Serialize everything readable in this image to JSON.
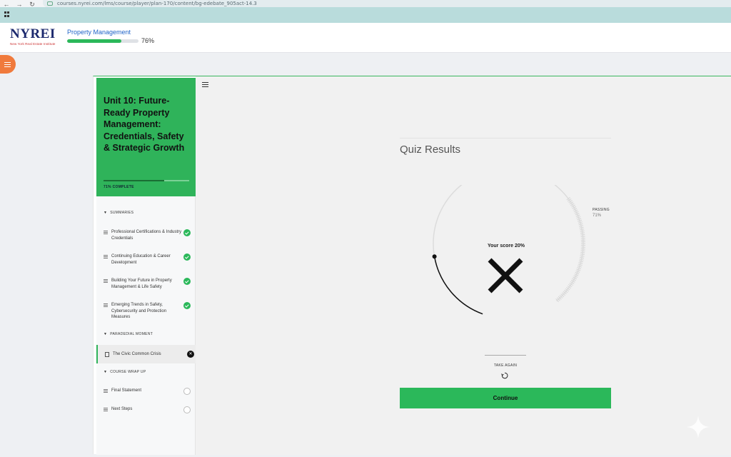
{
  "browser": {
    "url": "courses.nyrei.com/lms/course/player/plan-170/content/bg-edebate_905act-14.3",
    "back": "←",
    "forward": "→",
    "reload": "↻"
  },
  "header": {
    "logo_main": "NYREI",
    "logo_sub": "New York Real Estate Institute",
    "course_title": "Property Management",
    "progress_percent": 76,
    "progress_label": "76%"
  },
  "sidebar": {
    "unit_title": "Unit 10: Future-Ready Property Management: Credentials, Safety & Strategic Growth",
    "unit_progress": 71,
    "unit_complete_label": "71% COMPLETE",
    "sections": [
      {
        "title": "SUMMARIES",
        "lessons": [
          {
            "label": "Professional Certifications & Industry Credentials",
            "status": "done"
          },
          {
            "label": "Continuing Education & Career Development",
            "status": "done"
          },
          {
            "label": "Building Your Future in Property Management & Life Safety",
            "status": "done"
          },
          {
            "label": "Emerging Trends in Safety, Cybersecurity and Protection Measures",
            "status": "done"
          }
        ]
      },
      {
        "title": "PARADEDIAL MOMENT",
        "lessons": [
          {
            "label": "The Civic Common Crisis",
            "status": "fail"
          }
        ]
      },
      {
        "title": "COURSE WRAP UP",
        "lessons": [
          {
            "label": "Final Statement",
            "status": "todo"
          },
          {
            "label": "Next Steps",
            "status": "todo"
          }
        ]
      }
    ]
  },
  "quiz": {
    "title": "Quiz Results",
    "score_label": "Your score 20%",
    "score_percent": 20,
    "passing_label": "PASSING",
    "passing_value": "71%",
    "passing_percent": 71,
    "take_again_label": "TAKE AGAIN",
    "continue_label": "Continue"
  },
  "colors": {
    "accent_green": "#2bb85a",
    "brand_navy": "#1d2a6e",
    "menu_orange": "#f07a3c",
    "link_blue": "#1f63c8"
  }
}
